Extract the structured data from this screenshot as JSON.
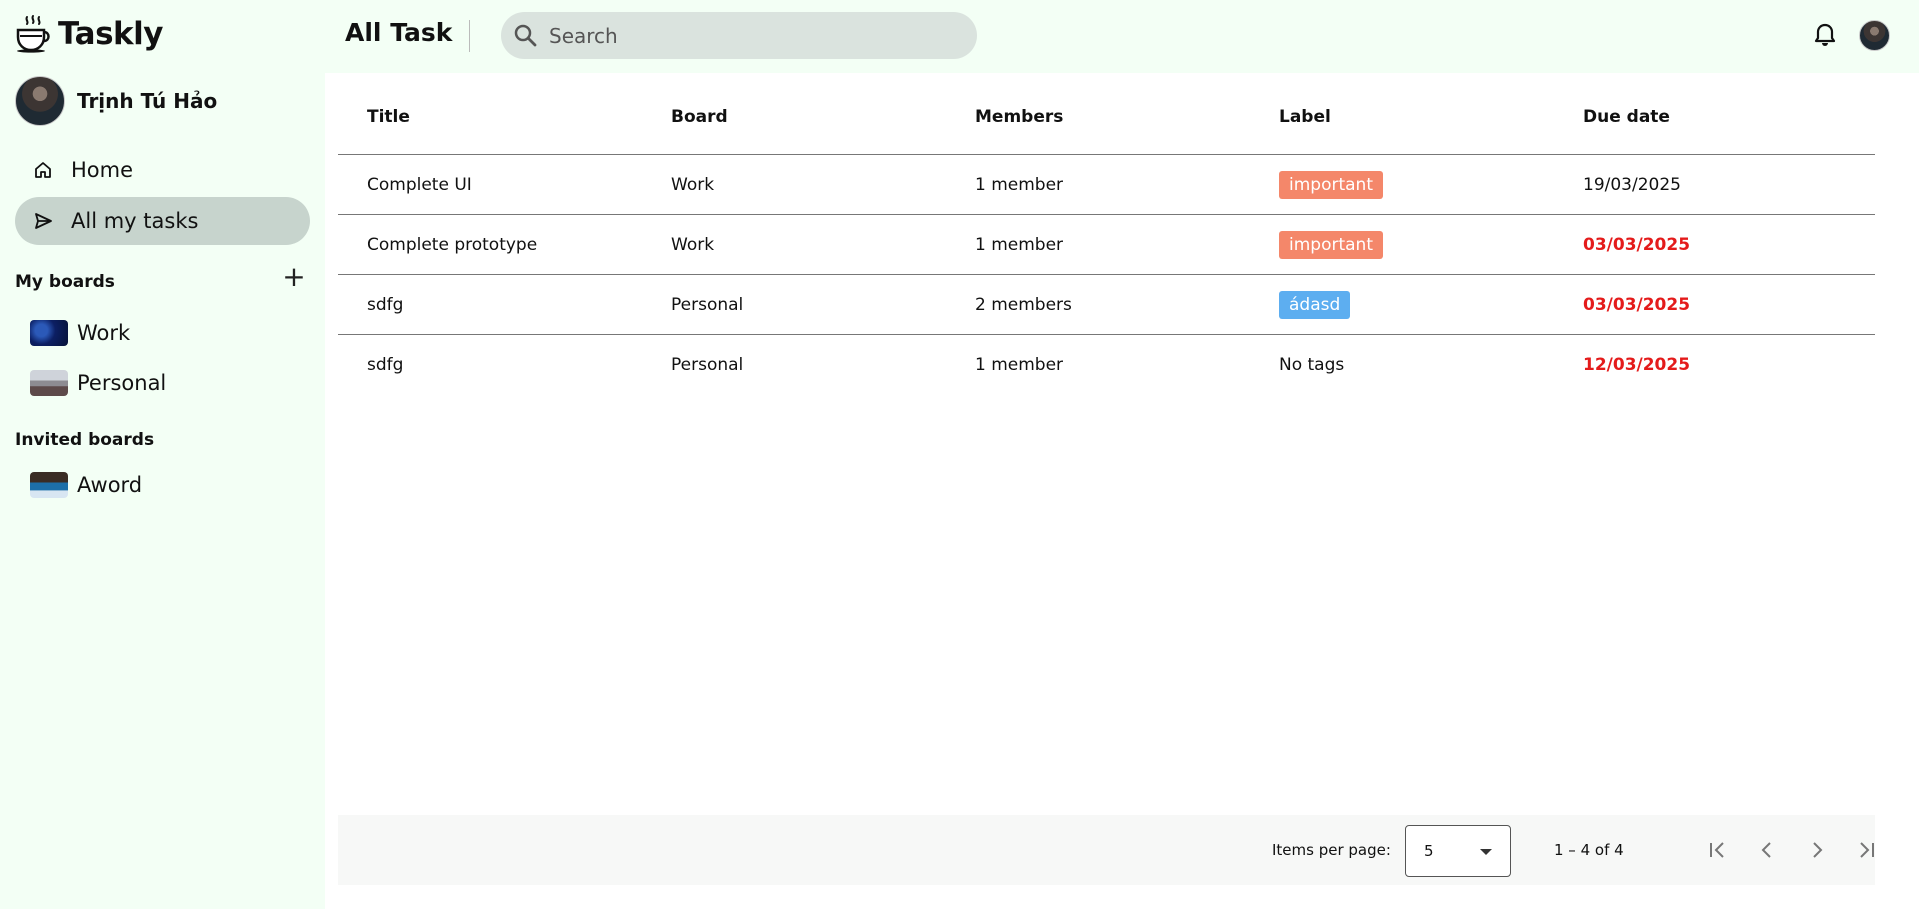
{
  "app": {
    "name": "Taskly"
  },
  "user": {
    "name": "Trịnh Tú Hảo"
  },
  "nav": [
    {
      "label": "Home",
      "icon": "home-icon"
    },
    {
      "label": "All my tasks",
      "icon": "send-icon",
      "active": true
    }
  ],
  "sections": {
    "my_boards": "My boards",
    "invited_boards": "Invited boards"
  },
  "my_boards": [
    {
      "label": "Work"
    },
    {
      "label": "Personal"
    }
  ],
  "invited_boards": [
    {
      "label": "Aword"
    }
  ],
  "header": {
    "title": "All Task",
    "search_placeholder": "Search"
  },
  "table": {
    "columns": [
      "Title",
      "Board",
      "Members",
      "Label",
      "Due date"
    ],
    "rows": [
      {
        "title": "Complete UI",
        "board": "Work",
        "members": "1 member",
        "label": "important",
        "label_color": "#f4876a",
        "due": "19/03/2025",
        "overdue": false
      },
      {
        "title": "Complete prototype",
        "board": "Work",
        "members": "1 member",
        "label": "important",
        "label_color": "#f4876a",
        "due": "03/03/2025",
        "overdue": true
      },
      {
        "title": "sdfg",
        "board": "Personal",
        "members": "2 members",
        "label": "ádasd",
        "label_color": "#5daef0",
        "due": "03/03/2025",
        "overdue": true
      },
      {
        "title": "sdfg",
        "board": "Personal",
        "members": "1 member",
        "label": "No tags",
        "label_color": null,
        "due": "12/03/2025",
        "overdue": true
      }
    ]
  },
  "paginator": {
    "items_per_page_label": "Items per page:",
    "items_per_page_value": "5",
    "range_label": "1 – 4 of 4"
  },
  "colors": {
    "background": "#f3fff5",
    "active_nav": "#c7d4cd",
    "search_bg": "#dae3de",
    "overdue": "#e41b1b"
  }
}
